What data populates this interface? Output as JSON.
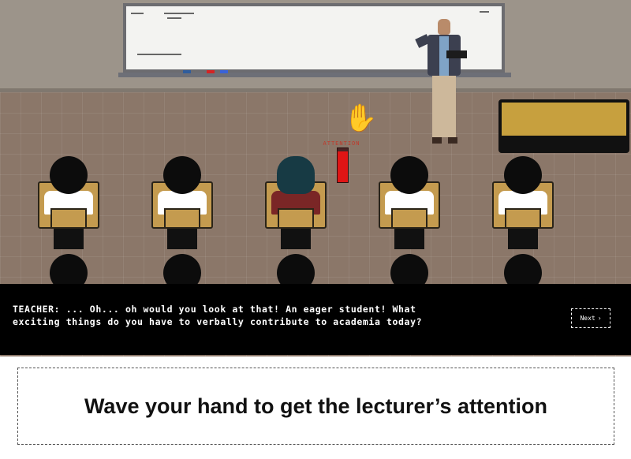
{
  "game": {
    "attention_meter": {
      "label": "ATTENTION",
      "fill_percent": 90,
      "color": "#e01515"
    },
    "hand_icon": "raised-hand-icon",
    "students_count_visible": 5
  },
  "dialog": {
    "text": "TEACHER: ... Oh... oh would you look at that! An eager student! What\nexciting things do you have to verbally contribute to academia today?",
    "next_label": "Next",
    "next_icon": "chevron-right-icon"
  },
  "instruction": {
    "text": "Wave your hand to get the lecturer’s attention"
  }
}
